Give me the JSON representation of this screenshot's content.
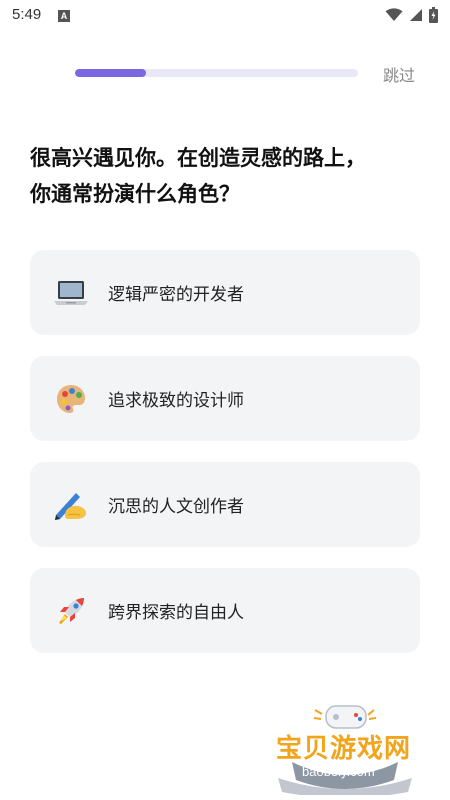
{
  "status_bar": {
    "time": "5:49",
    "notification_icon": "a-icon",
    "icons": [
      "wifi-icon",
      "signal-icon",
      "battery-icon"
    ]
  },
  "header": {
    "progress": 0.25,
    "skip_label": "跳过"
  },
  "question": {
    "line1": "很高兴遇见你。在创造灵感的路上，",
    "line2": "你通常扮演什么角色？"
  },
  "options": [
    {
      "icon": "laptop-icon",
      "label": "逻辑严密的开发者"
    },
    {
      "icon": "palette-icon",
      "label": "追求极致的设计师"
    },
    {
      "icon": "writing-hand-icon",
      "label": "沉思的人文创作者"
    },
    {
      "icon": "rocket-icon",
      "label": "跨界探索的自由人"
    }
  ],
  "watermark": {
    "title": "宝贝游戏网",
    "url": "baobeiy.com"
  },
  "colors": {
    "accent": "#7b68e0",
    "track": "#e9e8f7",
    "option_bg": "#f3f4f6",
    "watermark": "#f2a41c"
  }
}
